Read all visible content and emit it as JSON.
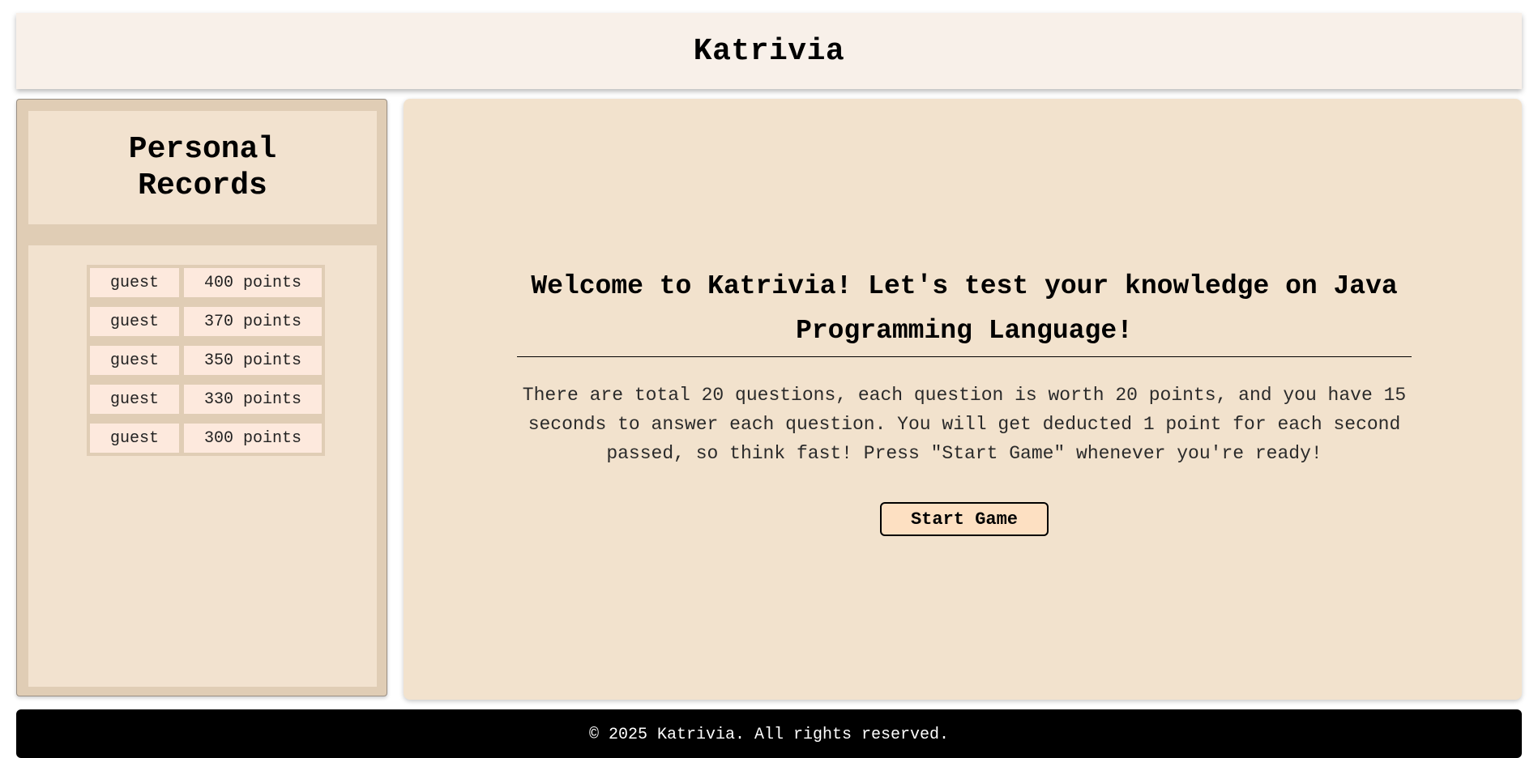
{
  "header": {
    "title": "Katrivia"
  },
  "sidebar": {
    "title": "Personal Records",
    "records": [
      {
        "name": "guest",
        "score": "400 points"
      },
      {
        "name": "guest",
        "score": "370 points"
      },
      {
        "name": "guest",
        "score": "350 points"
      },
      {
        "name": "guest",
        "score": "330 points"
      },
      {
        "name": "guest",
        "score": "300 points"
      }
    ]
  },
  "main": {
    "welcome": "Welcome to Katrivia! Let's test your knowledge on Java Programming Language!",
    "description": "There are total 20 questions, each question is worth 20 points, and you have 15 seconds to answer each question. You will get deducted 1 point for each second passed, so think fast! Press \"Start Game\" whenever you're ready!",
    "start_button": "Start Game"
  },
  "footer": {
    "text": "© 2025 Katrivia. All rights reserved."
  },
  "colors": {
    "header_bg": "#f8f0e9",
    "panel_bg": "#f2e2cd",
    "sidebar_border": "#e0cdb5",
    "record_cell": "#fde9dd",
    "button_bg": "#fde0c2",
    "footer_bg": "#000000"
  }
}
